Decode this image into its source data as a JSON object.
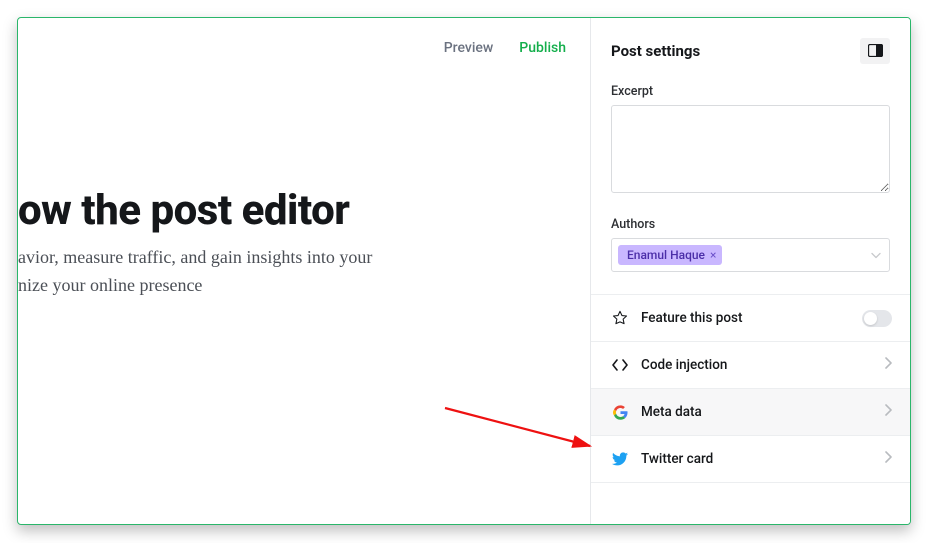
{
  "top": {
    "preview": "Preview",
    "publish": "Publish"
  },
  "post": {
    "title_visible": "ow the post editor",
    "body_line1": "avior, measure traffic, and gain insights into your",
    "body_line2": "nize your online presence"
  },
  "sidebar": {
    "title": "Post settings",
    "excerpt_label": "Excerpt",
    "excerpt_value": "",
    "authors_label": "Authors",
    "author_chip": "Enamul Haque",
    "rows": {
      "feature": "Feature this post",
      "code_injection": "Code injection",
      "meta_data": "Meta data",
      "twitter_card": "Twitter card"
    }
  }
}
